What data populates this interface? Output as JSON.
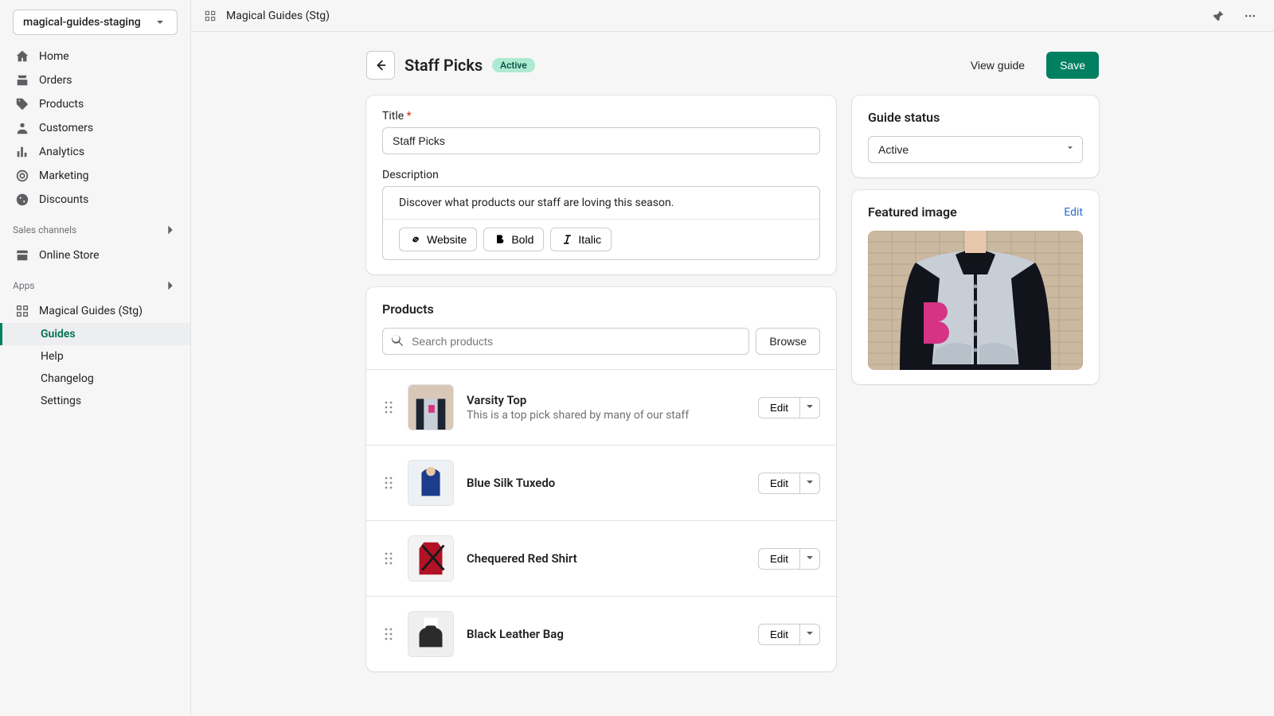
{
  "store_switcher": {
    "label": "magical-guides-staging"
  },
  "topbar": {
    "breadcrumb": "Magical Guides (Stg)"
  },
  "sidebar": {
    "primary": [
      {
        "label": "Home"
      },
      {
        "label": "Orders"
      },
      {
        "label": "Products"
      },
      {
        "label": "Customers"
      },
      {
        "label": "Analytics"
      },
      {
        "label": "Marketing"
      },
      {
        "label": "Discounts"
      }
    ],
    "channels_heading": "Sales channels",
    "channels": [
      {
        "label": "Online Store"
      }
    ],
    "apps_heading": "Apps",
    "apps": [
      {
        "label": "Magical Guides (Stg)",
        "sub": [
          {
            "label": "Guides",
            "selected": true
          },
          {
            "label": "Help"
          },
          {
            "label": "Changelog"
          },
          {
            "label": "Settings"
          }
        ]
      }
    ]
  },
  "page": {
    "title": "Staff Picks",
    "badge": "Active",
    "view_guide": "View guide",
    "save": "Save"
  },
  "form": {
    "title_label": "Title",
    "title_value": "Staff Picks",
    "desc_label": "Description",
    "desc_value": "Discover what products our staff are loving this season.",
    "tool_website": "Website",
    "tool_bold": "Bold",
    "tool_italic": "Italic"
  },
  "products_card": {
    "heading": "Products",
    "search_placeholder": "Search products",
    "browse": "Browse",
    "edit": "Edit",
    "rows": [
      {
        "title": "Varsity Top",
        "subtitle": "This is a top pick shared by many of our staff"
      },
      {
        "title": "Blue Silk Tuxedo"
      },
      {
        "title": "Chequered Red Shirt"
      },
      {
        "title": "Black Leather Bag"
      }
    ]
  },
  "status_card": {
    "heading": "Guide status",
    "value": "Active"
  },
  "featured_card": {
    "heading": "Featured image",
    "edit": "Edit"
  }
}
